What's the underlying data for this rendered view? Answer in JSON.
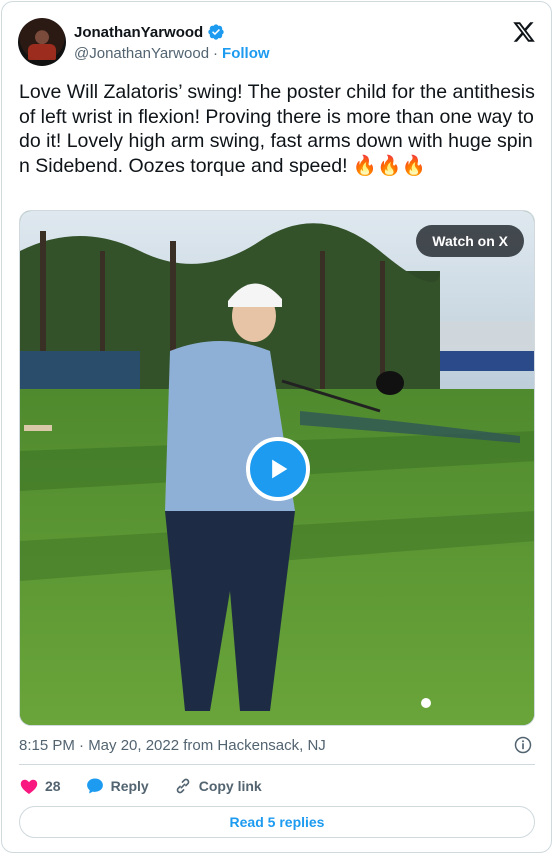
{
  "author": {
    "display_name": "JonathanYarwood",
    "handle": "@JonathanYarwood",
    "separator": "·",
    "follow_label": "Follow"
  },
  "tweet": {
    "text": "Love Will Zalatoris’ swing! The poster child for the antithesis of left wrist in flexion! Proving there is more than one way to do it! Lovely high arm swing, fast arms down with huge spin n Sidebend. Oozes torque and speed! 🔥🔥🔥"
  },
  "media": {
    "watch_label": "Watch on X"
  },
  "meta": {
    "timestamp": "8:15 PM · May 20, 2022 from Hackensack, NJ"
  },
  "actions": {
    "like_count": "28",
    "reply_label": "Reply",
    "copy_label": "Copy link"
  },
  "footer": {
    "read_replies_label": "Read 5 replies"
  },
  "colors": {
    "accent": "#1d9bf0",
    "like": "#f91880",
    "text_primary": "#0f1419",
    "text_secondary": "#536471",
    "border": "#cfd9de"
  },
  "icons": [
    "verified-badge-icon",
    "x-logo-icon",
    "play-icon",
    "info-icon",
    "heart-icon",
    "reply-bubble-icon",
    "link-icon"
  ]
}
